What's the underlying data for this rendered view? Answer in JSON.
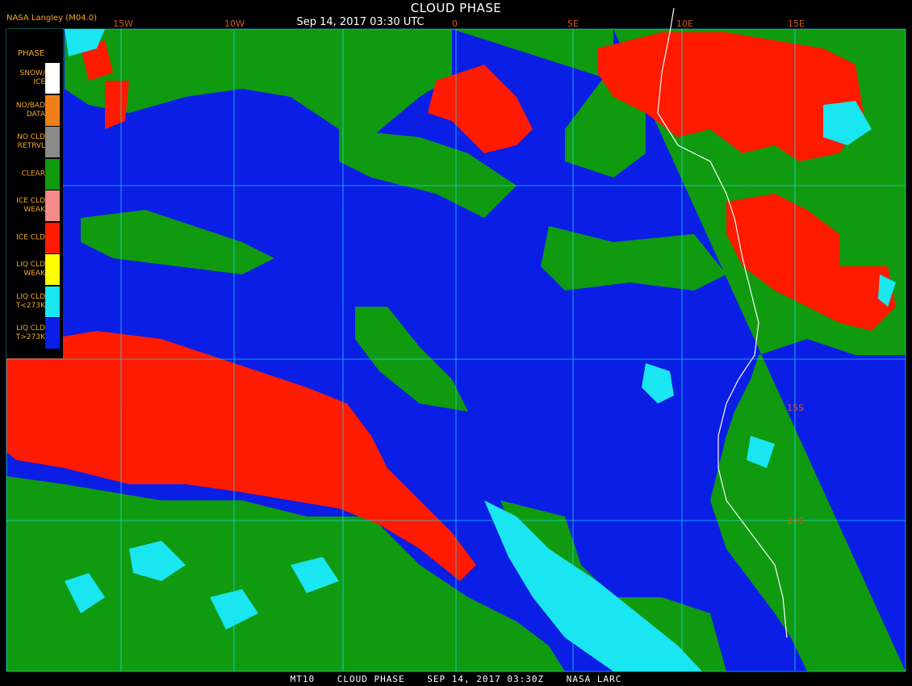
{
  "header": {
    "title": "CLOUD PHASE",
    "date": "Sep 14, 2017 03:30 UTC",
    "credit": "NASA Langley (M04.0)"
  },
  "legend": {
    "title": "PHASE",
    "items": [
      {
        "label": "SNOW/\nICE",
        "color": "#ffffff"
      },
      {
        "label": "NO/BAD\nDATA",
        "color": "#f07f1a"
      },
      {
        "label": "NO CLD\nRETRVL",
        "color": "#8a8a8a"
      },
      {
        "label": "CLEAR",
        "color": "#0f9a10"
      },
      {
        "label": "ICE CLD\nWEAK",
        "color": "#f58a8a"
      },
      {
        "label": "ICE CLD",
        "color": "#ff1a00"
      },
      {
        "label": "LIQ CLD\nWEAK",
        "color": "#ffff00"
      },
      {
        "label": "LIQ CLD\nT<273K",
        "color": "#19e6f0"
      },
      {
        "label": "LIQ CLD\nT>273K",
        "color": "#0a1ee6"
      }
    ]
  },
  "grid": {
    "longitudes": [
      "15W",
      "10W",
      "0",
      "5E",
      "10E",
      "15E"
    ],
    "latitudes": [
      "15S",
      "20S"
    ]
  },
  "footer": {
    "parts": [
      "MT10",
      "CLOUD PHASE",
      "SEP 14, 2017 03:30Z",
      "NASA LARC"
    ]
  },
  "colors": {
    "ocean_liquid": "#0a1ee6",
    "clear": "#0f9a10",
    "ice": "#ff1a00",
    "liquid_cold": "#19e6f0",
    "gridline": "#19e6f0",
    "coast": "#ffffff"
  }
}
